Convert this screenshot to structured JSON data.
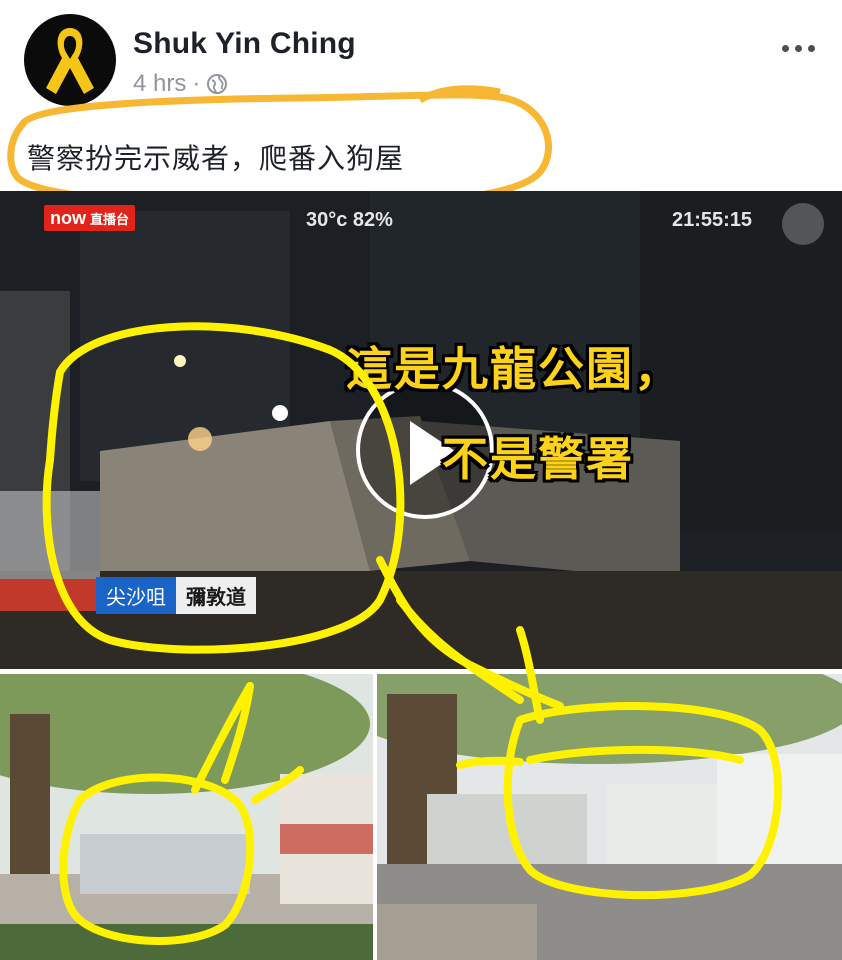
{
  "post": {
    "author": "Shuk Yin Ching",
    "time": "4 hrs",
    "separator": "·",
    "text": "警察扮完示威者，爬番入狗屋"
  },
  "icons": {
    "avatar": "yellow-ribbon-icon",
    "audience": "globe-icon",
    "menu": "more-options-icon",
    "play": "play-icon"
  },
  "video": {
    "logo_main": "now",
    "logo_sub": "直播台",
    "weather": "30°c  82%",
    "clock": "21:55:15",
    "caption_line1": "這是九龍公園，",
    "caption_line2": "不是警署",
    "district": "尖沙咀",
    "street": "彌敦道"
  },
  "colors": {
    "highlight_orange": "#f7b733",
    "highlight_yellow": "#fff200",
    "caption_yellow": "#ffd21a",
    "ribbon_yellow": "#f5c518"
  }
}
